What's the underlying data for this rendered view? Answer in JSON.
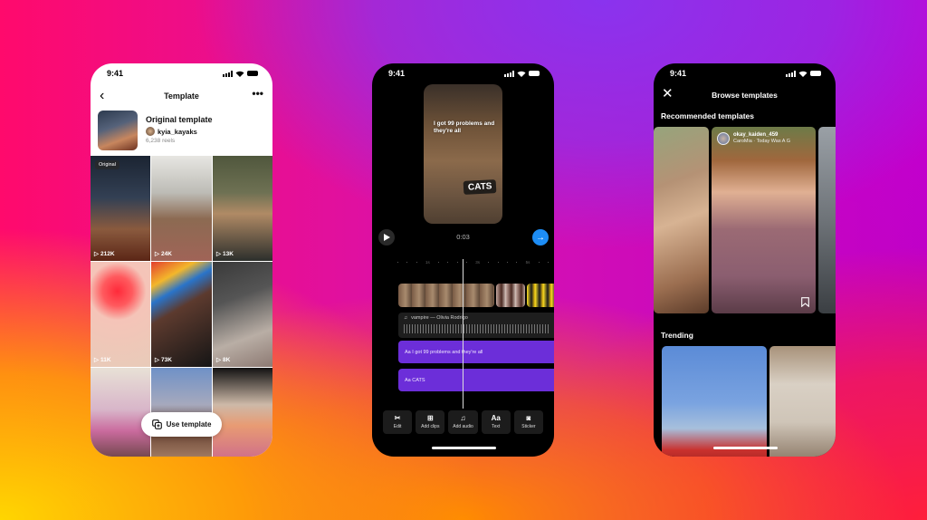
{
  "background": {
    "colors": [
      "#ff0a6c",
      "#c000c8",
      "#8a33ee",
      "#ff8a00",
      "#ffd600",
      "#ff1f3a"
    ]
  },
  "phones": {
    "template": {
      "status": {
        "time": "9:41"
      },
      "nav": {
        "back_icon": "chevron-left-icon",
        "title": "Template",
        "more_icon": "more-horizontal-icon",
        "more_label": "•••"
      },
      "original": {
        "title": "Original template",
        "username": "kyia_kayaks",
        "reels_count": "6,238 reels"
      },
      "grid": [
        {
          "badge": "Original",
          "views": "212K"
        },
        {
          "views": "24K"
        },
        {
          "views": "13K"
        },
        {
          "views": "11K"
        },
        {
          "views": "73K"
        },
        {
          "views": "8K"
        },
        {
          "views": ""
        },
        {
          "views": ""
        },
        {
          "views": ""
        }
      ],
      "use_template_label": "Use template"
    },
    "editor": {
      "status": {
        "time": "9:41"
      },
      "preview": {
        "caption": "I got 99 problems and they're all",
        "sticker": "CATS"
      },
      "playback_time": "0:03",
      "ruler_labels": [
        "1s",
        "3s",
        "5s"
      ],
      "audio_track": {
        "icon": "♫",
        "title": "vampire — Olivia Rodrigo"
      },
      "text_tracks": [
        {
          "icon": "Aa",
          "text": "I got 99 problems and they're all"
        },
        {
          "icon": "Aa",
          "text": "CATS"
        }
      ],
      "tools": [
        {
          "icon": "scissors-icon",
          "glyph": "✂",
          "label": "Edit"
        },
        {
          "icon": "add-clips-icon",
          "glyph": "⊞",
          "label": "Add clips"
        },
        {
          "icon": "music-note-icon",
          "glyph": "♫",
          "label": "Add audio"
        },
        {
          "icon": "text-icon",
          "glyph": "Aa",
          "label": "Text"
        },
        {
          "icon": "sticker-icon",
          "glyph": "◙",
          "label": "Sticker"
        }
      ],
      "accent_color": "#1d8df5",
      "track_color": "#6c2ed9"
    },
    "browse": {
      "status": {
        "time": "9:41"
      },
      "nav": {
        "close_icon": "close-icon",
        "close_glyph": "✕",
        "title": "Browse templates"
      },
      "recommended_title": "Recommended templates",
      "recommended_card": {
        "username": "okay_kaiden_459",
        "song": "CaroMia · Today Was A G"
      },
      "trending_title": "Trending"
    }
  }
}
